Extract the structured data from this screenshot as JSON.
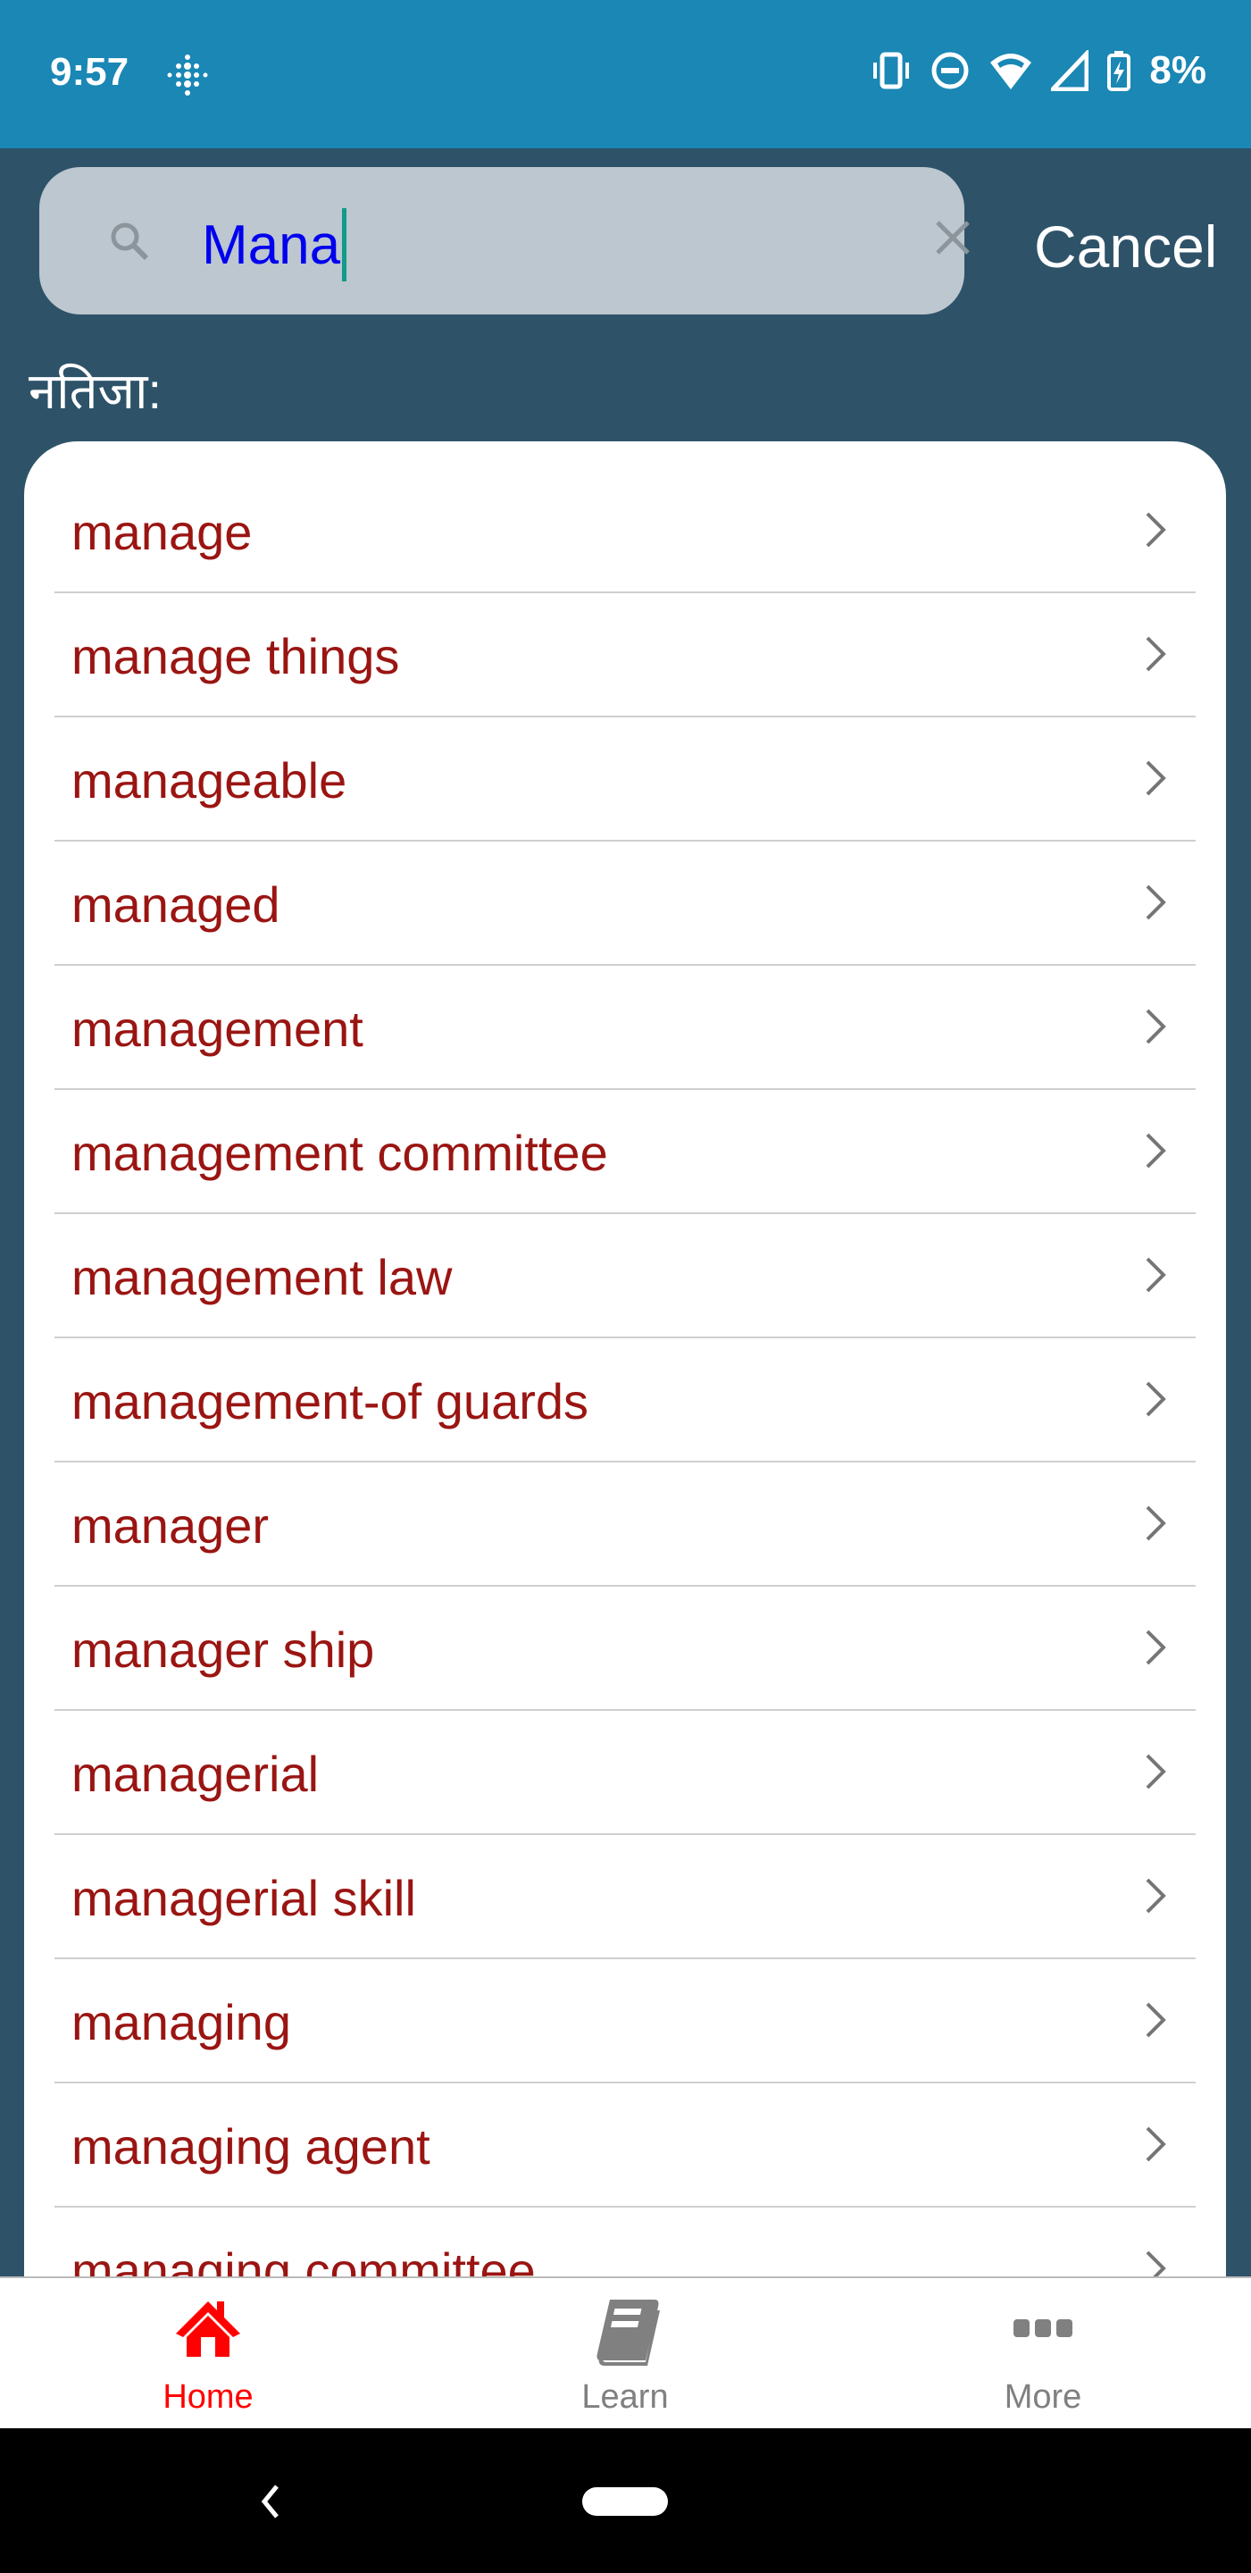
{
  "status_bar": {
    "time": "9:57",
    "battery": "8%",
    "icons": [
      "fitbit-icon",
      "vibrate-icon",
      "do-not-disturb-icon",
      "wifi-icon",
      "signal-icon",
      "battery-charging-icon"
    ]
  },
  "search": {
    "value": "Mana",
    "cancel_label": "Cancel"
  },
  "results_label": "नतिजा:",
  "results": [
    "manage",
    "manage things",
    "manageable",
    "managed",
    "management",
    "management committee",
    "management law",
    "management-of guards",
    "manager",
    "manager ship",
    "managerial",
    "managerial skill",
    "managing",
    "managing agent",
    "managing committee"
  ],
  "bottom_nav": [
    {
      "label": "Home",
      "icon": "home-icon",
      "active": true
    },
    {
      "label": "Learn",
      "icon": "book-icon",
      "active": false
    },
    {
      "label": "More",
      "icon": "more-icon",
      "active": false
    }
  ],
  "colors": {
    "status_bar": "#1a87b5",
    "background": "#2e5369",
    "result_text": "#9a1512",
    "active_tab": "#ff0000",
    "inactive_tab": "#808080"
  }
}
